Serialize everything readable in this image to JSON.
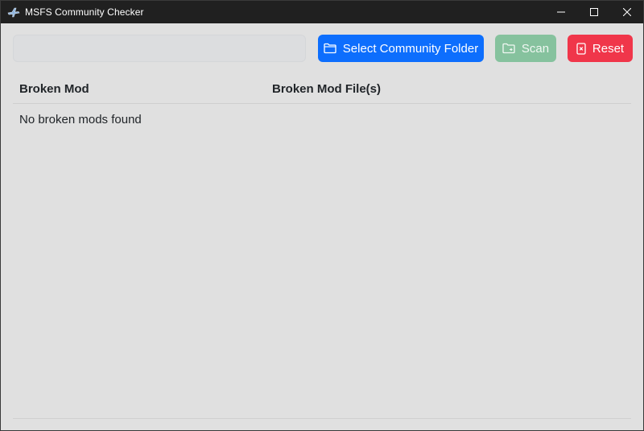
{
  "window": {
    "title": "MSFS Community Checker",
    "controls": {
      "minimize_icon": "minimize-icon",
      "maximize_icon": "maximize-icon",
      "close_icon": "close-icon"
    }
  },
  "toolbar": {
    "folder_path": {
      "value": "",
      "placeholder": ""
    },
    "select_folder_label": "Select Community Folder",
    "scan_label": "Scan",
    "reset_label": "Reset"
  },
  "table": {
    "columns": [
      "Broken Mod",
      "Broken Mod File(s)"
    ],
    "rows": [],
    "empty_message": "No broken mods found"
  },
  "colors": {
    "titlebar": "#202020",
    "background": "#e0e0e0",
    "primary": "#0d6efd",
    "success_disabled": "#86c29e",
    "danger": "#f0364a"
  }
}
